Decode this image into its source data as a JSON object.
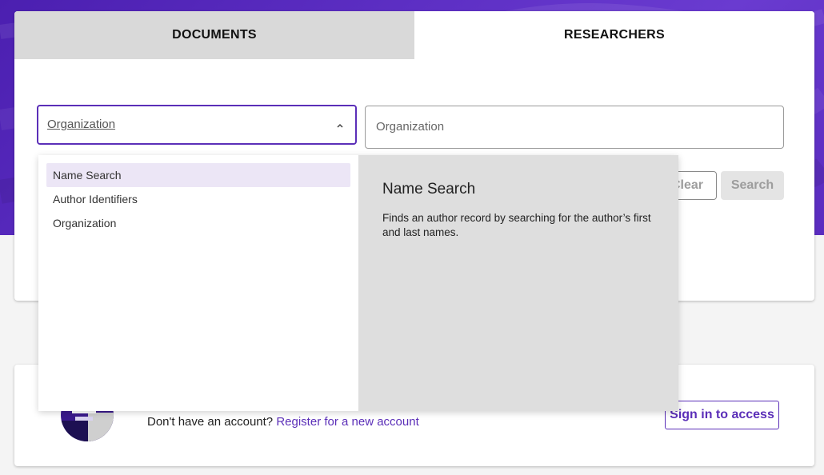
{
  "tabs": [
    {
      "label": "DOCUMENTS",
      "active": false
    },
    {
      "label": "RESEARCHERS",
      "active": true
    }
  ],
  "search": {
    "select_value": "Organization",
    "input_placeholder": "Organization",
    "clear_label": "Clear",
    "search_label": "Search"
  },
  "dropdown": {
    "options": [
      "Name Search",
      "Author Identifiers",
      "Organization"
    ],
    "highlighted": "Name Search",
    "detail_title": "Name Search",
    "detail_description": "Finds an author record by searching for the author’s first and last names."
  },
  "account": {
    "prompt": "Don't have an account?",
    "register_link": "Register for a new account",
    "signin_label": "Sign in to access"
  },
  "colors": {
    "accent": "#5b2fb8",
    "hero": "#5a2cbf",
    "selected_option": "#ece6f6",
    "detail_panel": "#dedede"
  },
  "icons": [
    "chevron-up-icon",
    "avatar-illustration"
  ]
}
